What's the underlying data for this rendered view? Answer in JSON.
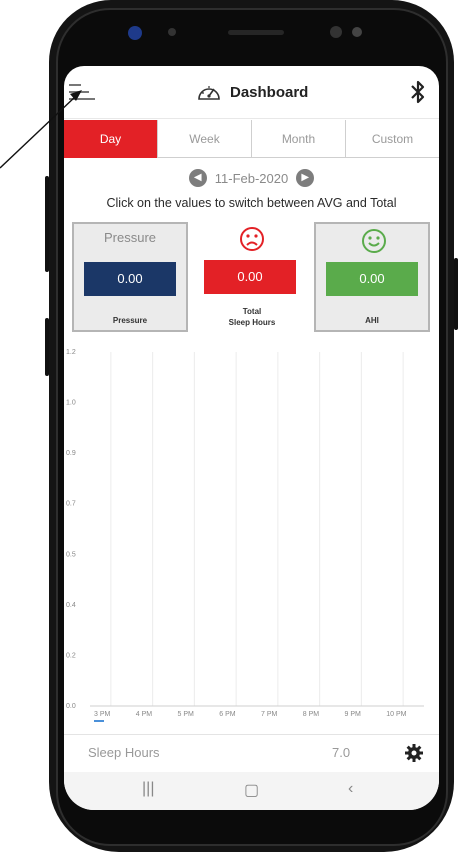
{
  "header": {
    "title": "Dashboard"
  },
  "tabs": [
    {
      "label": "Day",
      "active": true
    },
    {
      "label": "Week",
      "active": false
    },
    {
      "label": "Month",
      "active": false
    },
    {
      "label": "Custom",
      "active": false
    }
  ],
  "date": {
    "value": "11-Feb-2020"
  },
  "hint": "Click on the values to switch between AVG and Total",
  "cards": {
    "pressure": {
      "title": "Pressure",
      "value": "0.00",
      "label": "Pressure",
      "color": "#1b3767"
    },
    "sleep": {
      "value": "0.00",
      "label_line1": "Total",
      "label_line2": "Sleep Hours",
      "color": "#e32126",
      "face": "frown-face-icon"
    },
    "ahi": {
      "value": "0.00",
      "label": "AHI",
      "color": "#5aab4b",
      "face": "smile-face-icon"
    }
  },
  "chart_data": {
    "type": "bar",
    "categories": [
      "3 PM",
      "4 PM",
      "5 PM",
      "6 PM",
      "7 PM",
      "8 PM",
      "9 PM",
      "10 PM"
    ],
    "values": [
      0,
      0,
      0,
      0,
      0,
      0,
      0,
      0
    ],
    "y_ticks": [
      "1.2",
      "1.0",
      "0.9",
      "0.7",
      "0.5",
      "0.4",
      "0.2",
      "0.0"
    ],
    "ylim": [
      0,
      1.2
    ],
    "grid": "vertical"
  },
  "bottom": {
    "label": "Sleep Hours",
    "value": "7.0"
  },
  "colors": {
    "accent": "#e32126",
    "navy": "#1b3767",
    "green": "#5aab4b"
  }
}
